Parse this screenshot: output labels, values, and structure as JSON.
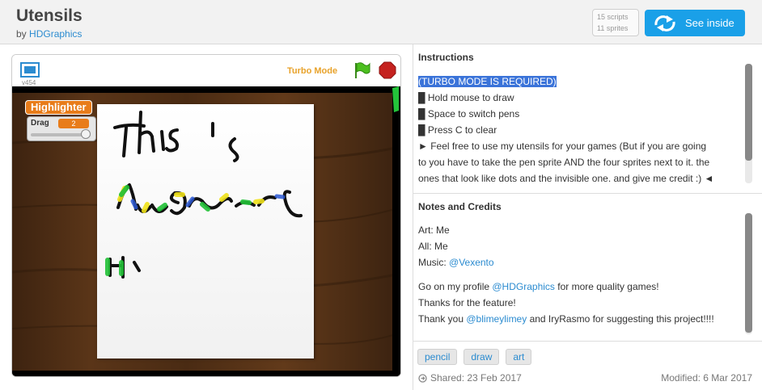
{
  "project": {
    "title": "Utensils",
    "by": "by",
    "author": "HDGraphics",
    "scripts": "15 scripts",
    "sprites": "11 sprites",
    "see_inside": "See inside"
  },
  "player": {
    "version": "v454",
    "turbo_label": "Turbo Mode",
    "monitor": {
      "name": "Highlighter",
      "label": "Drag",
      "value": "2",
      "slider_level": 0.9
    }
  },
  "instructions": {
    "heading": "Instructions",
    "lines": [
      "(TURBO MODE IS REQUIRED)",
      "█ Hold mouse to draw",
      "█ Space to switch pens",
      "█ Press C to clear",
      "► Feel free to use my utensils for your games (But if you are going",
      "to you have to take the pen sprite AND the four sprites next to it. the",
      "ones that look like dots and the invisible one. and give me credit :) ◄"
    ]
  },
  "notes": {
    "heading": "Notes and Credits",
    "art": "Art: Me",
    "all": "All: Me",
    "music_prefix": "Music: ",
    "music_link": "@Vexento",
    "profile_prefix": "Go on my profile ",
    "profile_link": "@HDGraphics",
    "profile_suffix": " for more quality games!",
    "thanks": "Thanks for the feature!",
    "thank_prefix": "Thank you ",
    "thank_link": "@blimeylimey",
    "thank_suffix": " and IryRasmo for suggesting this project!!!!"
  },
  "tags": [
    "pencil",
    "draw",
    "art"
  ],
  "shared": "Shared: 23 Feb 2017",
  "modified": "Modified: 6 Mar 2017",
  "colors": {
    "accent": "#1aa0e8",
    "turbo": "#e8a22a",
    "monitor": "#e87c1a",
    "link": "#2b8bd0"
  }
}
